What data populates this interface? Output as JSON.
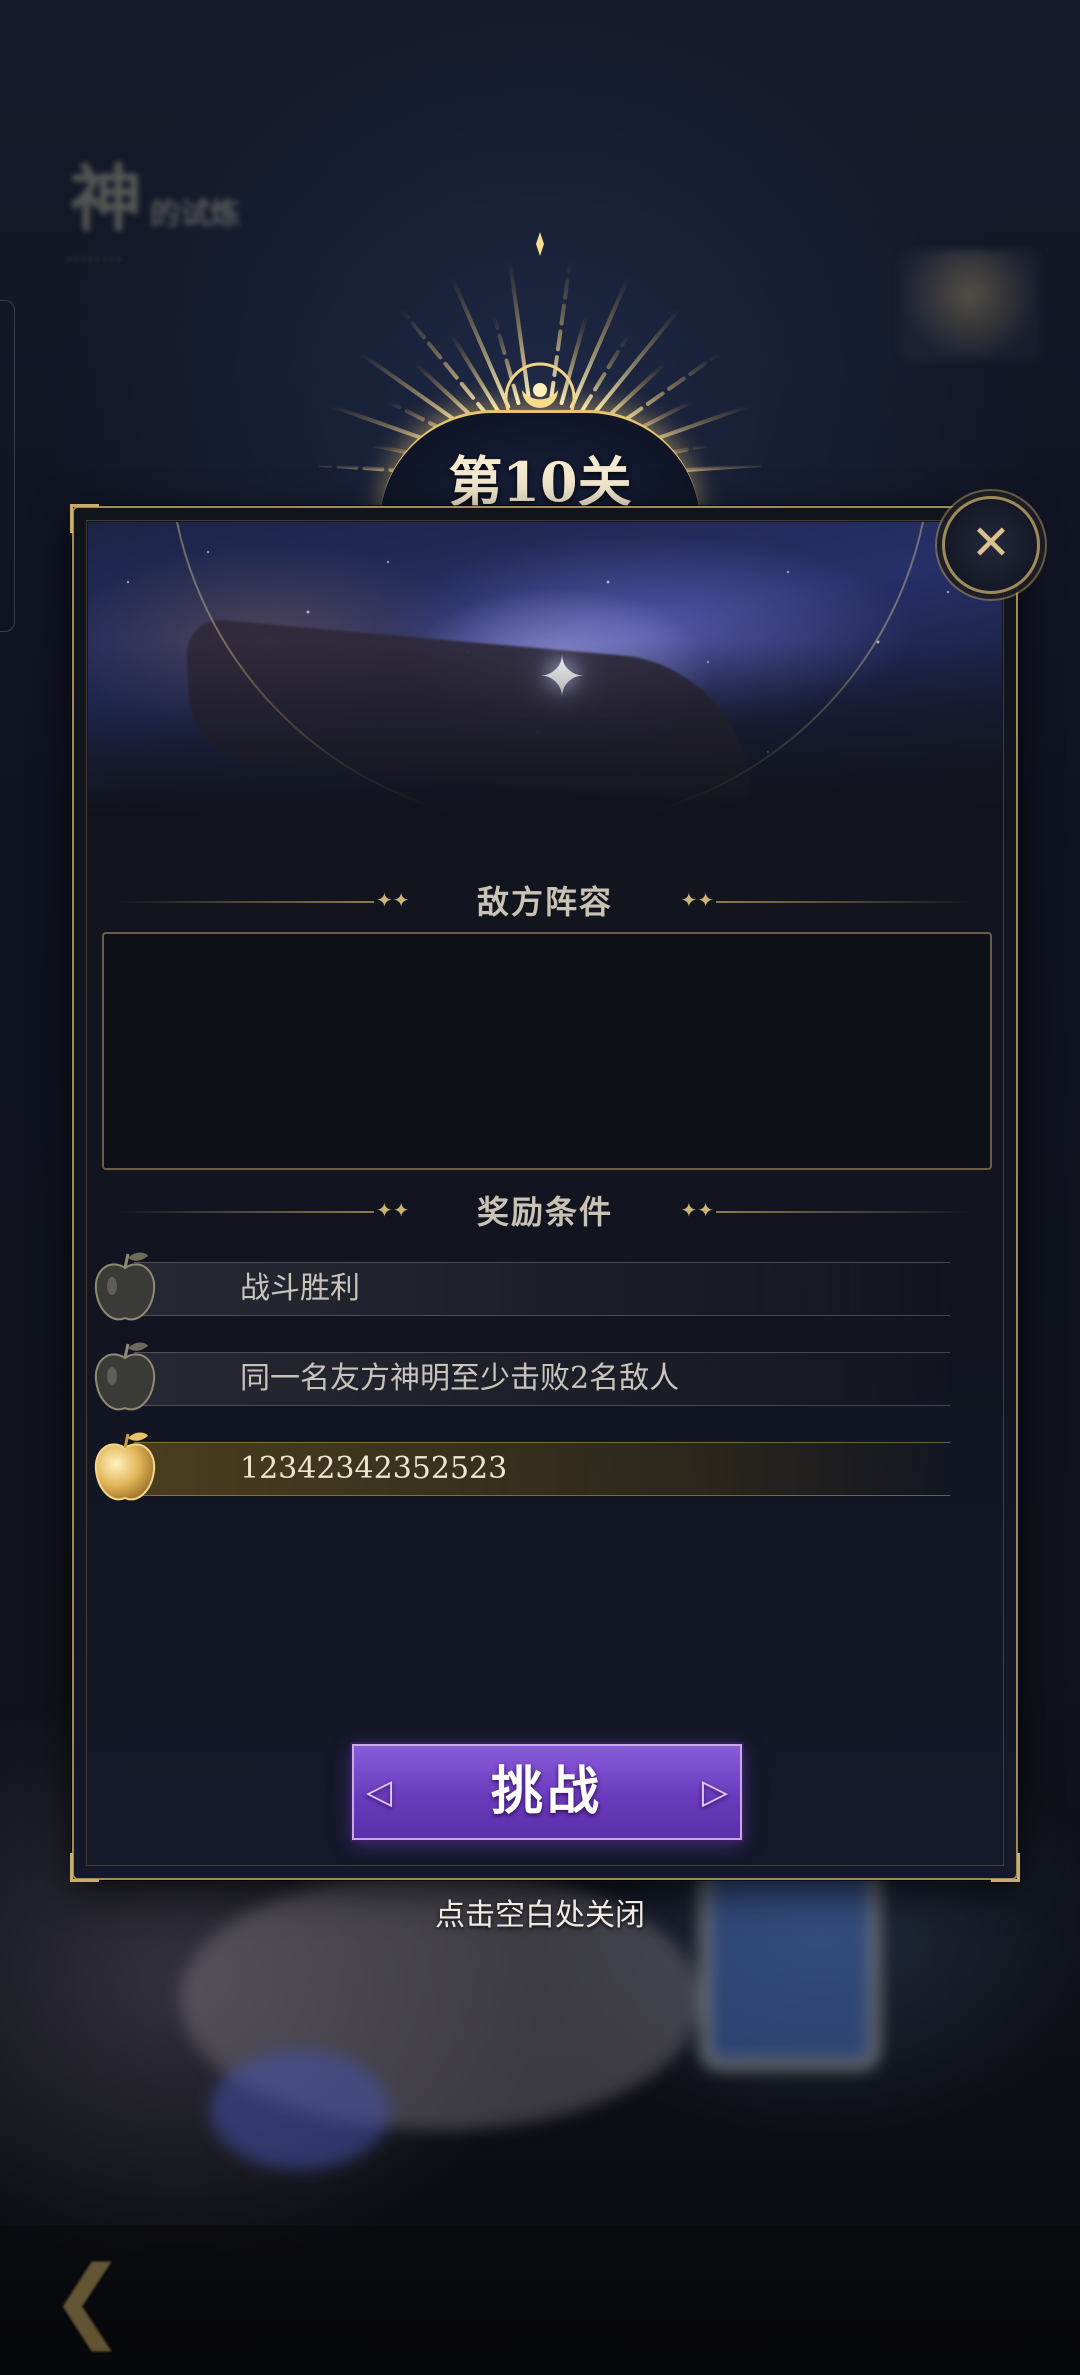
{
  "level": {
    "title": "第10关"
  },
  "sections": {
    "enemy_title": "敌方阵容",
    "reward_title": "奖励条件"
  },
  "rewards": [
    {
      "text": "战斗胜利",
      "achieved": false
    },
    {
      "text": "同一名友方神明至少击败2名敌人",
      "achieved": false
    },
    {
      "text": "12342342352523",
      "achieved": true
    }
  ],
  "buttons": {
    "challenge": "挑战"
  },
  "hint": {
    "close": "点击空白处关闭"
  },
  "icons": {
    "close": "close-x-icon",
    "reward": "golden-apple-icon",
    "back": "back-arrow-icon"
  },
  "colors": {
    "gold": "#c9ad6c",
    "challenge_button": "#6a3bbd",
    "panel_bg": "#12141d"
  }
}
